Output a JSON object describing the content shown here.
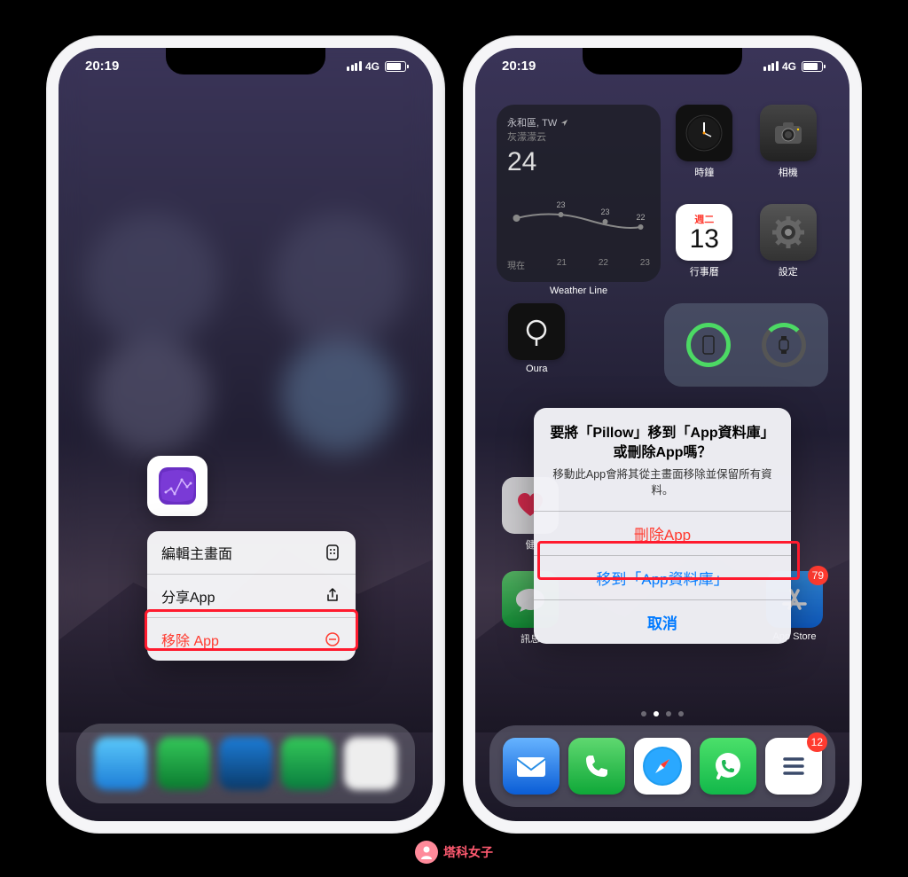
{
  "status": {
    "time": "20:19",
    "network": "4G"
  },
  "phone1": {
    "menu": {
      "edit": "編輯主畫面",
      "share": "分享App",
      "remove": "移除 App"
    }
  },
  "phone2": {
    "weather": {
      "location": "永和區, TW",
      "cond": "灰濛濛云",
      "temp": "24",
      "hi": "23",
      "mid": "23",
      "lo": "22",
      "now_label": "現在",
      "app_label": "Weather Line"
    },
    "apps": {
      "clock": "時鐘",
      "camera": "相機",
      "calendar": "行事曆",
      "cal_dow": "週二",
      "cal_day": "13",
      "settings": "設定",
      "oura": "Oura",
      "health_short": "健",
      "messages": "訊息",
      "appstore": "App Store"
    },
    "alert": {
      "title": "要將「Pillow」移到「App資料庫」或刪除App嗎？",
      "message": "移動此App會將其從主畫面移除並保留所有資料。",
      "delete": "刪除App",
      "move": "移到「App資料庫」",
      "cancel": "取消"
    },
    "badges": {
      "appstore": "79",
      "things": "12"
    }
  },
  "watermark": "塔科女子"
}
